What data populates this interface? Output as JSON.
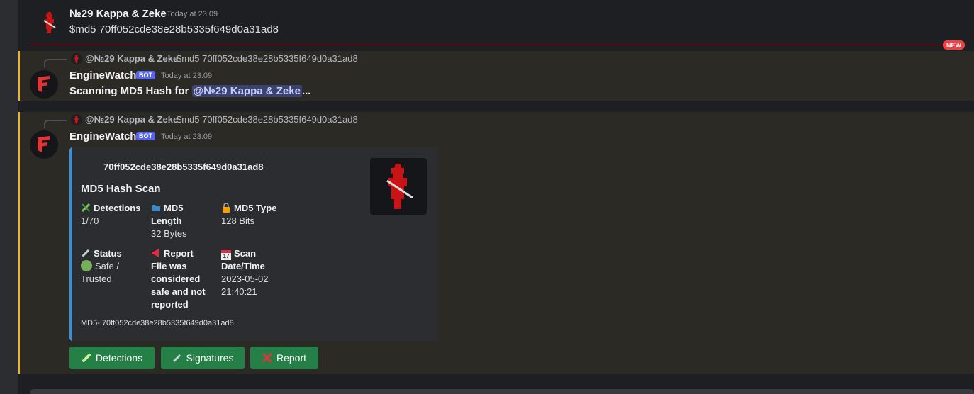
{
  "messages": [
    {
      "author": "№29 Kappa & Zeke",
      "timestamp": "Today at 23:09",
      "content": "$md5 70ff052cde38e28b5335f649d0a31ad8",
      "avatar_icon": "red-soldier-avatar-icon"
    },
    {
      "author": "EngineWatch",
      "bot_tag": "BOT",
      "timestamp": "Today at 23:09",
      "reply": {
        "author": "@№29 Kappa & Zeke",
        "content": "$md5 70ff052cde38e28b5335f649d0a31ad8"
      },
      "content_prefix": "Scanning MD5 Hash for ",
      "mention": "@№29 Kappa & Zeke",
      "content_suffix": "...",
      "avatar_icon": "enginewatch-logo-icon"
    },
    {
      "author": "EngineWatch",
      "bot_tag": "BOT",
      "timestamp": "Today at 23:09",
      "reply": {
        "author": "@№29 Kappa & Zeke",
        "content": "$md5 70ff052cde38e28b5335f649d0a31ad8"
      },
      "avatar_icon": "enginewatch-logo-icon",
      "embed": {
        "author": "70ff052cde38e28b5335f649d0a31ad8",
        "title": "MD5 Hash Scan",
        "accent": "#3e8ed0",
        "fields": [
          {
            "icon": "dna-icon",
            "name": "Detections",
            "value": "1/70"
          },
          {
            "icon": "folder-icon",
            "name": "MD5 Length",
            "value": "32 Bytes"
          },
          {
            "icon": "lock-icon",
            "name": "MD5 Type",
            "value": "128 Bits"
          },
          {
            "icon": "syringe-icon",
            "name": "Status",
            "value": "Safe / Trusted",
            "value_icon": "green-circle-icon"
          },
          {
            "icon": "megaphone-icon",
            "name": "Report",
            "value": "File was considered safe and not reported"
          },
          {
            "icon": "calendar-icon",
            "name": "Scan Date/Time",
            "value": "2023-05-02 21:40:21",
            "icon_text": "17"
          }
        ],
        "footer": "MD5- 70ff052cde38e28b5335f649d0a31ad8"
      },
      "buttons": [
        {
          "label": "Detections",
          "icon": "test-tube-icon"
        },
        {
          "label": "Signatures",
          "icon": "syringe-icon"
        },
        {
          "label": "Report",
          "icon": "red-x-icon"
        }
      ]
    }
  ],
  "divider": {
    "label": "NEW",
    "color": "#f23f43"
  },
  "colors": {
    "background": "#1e1f22",
    "highlight": "#2c2a24",
    "highlight_border": "#f0b232",
    "button": "#248046",
    "bot_tag": "#5865f2"
  }
}
